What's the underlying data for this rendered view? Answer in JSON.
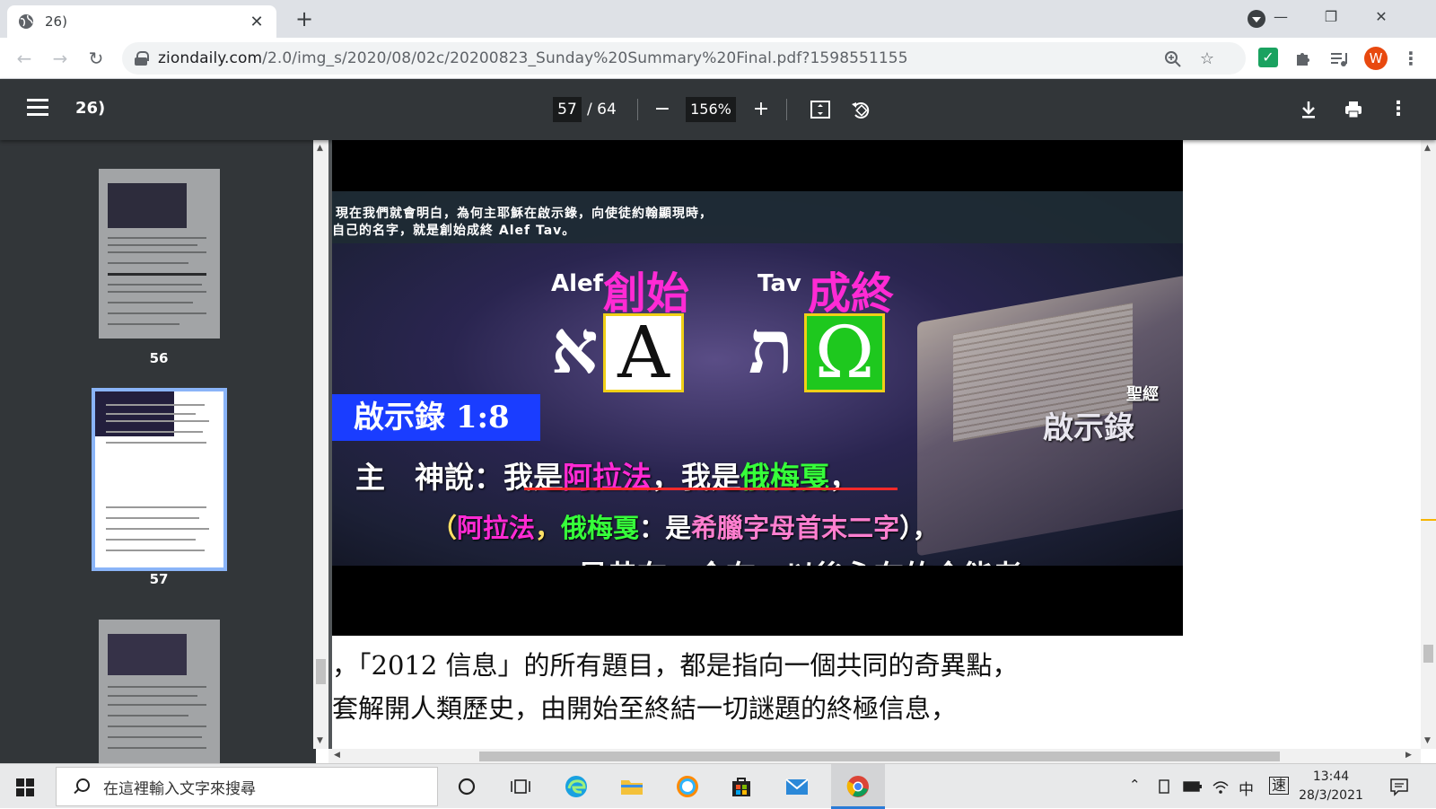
{
  "browser": {
    "tab_title": "26)",
    "tab_close": "✕",
    "new_tab": "+",
    "window_controls": [
      "—",
      "❐",
      "✕"
    ],
    "url_host": "ziondaily.com",
    "url_path": "/2.0/img_s/2020/08/02c/20200823_Sunday%20Summary%20Final.pdf?1598551155",
    "profile_initial": "W"
  },
  "pdf_toolbar": {
    "title": "26)",
    "current_page": "57",
    "page_separator": "/ 64",
    "zoom": "156%"
  },
  "sidebar": {
    "thumbnails": [
      {
        "page": "56"
      },
      {
        "page": "57"
      },
      {
        "page": ""
      }
    ]
  },
  "video_frame": {
    "caption_line1": "現在我們就會明白，為何主耶穌在啟示錄，向使徒約翰顯現時，",
    "caption_line2": "自己的名字，就是創始成終 Alef Tav。",
    "alef_label": "Alef",
    "alef_word": "創始",
    "tav_label": "Tav",
    "tav_word": "成終",
    "hebrew_alef": "א",
    "greek_alpha": "A",
    "hebrew_tav": "ת",
    "greek_omega": "Ω",
    "reference": "啟示錄 1:8",
    "bible_label_small": "聖經",
    "bible_label_big": "啟示錄",
    "line_a_prefix": "主　神說：我是",
    "line_a_alpha": "阿拉法",
    "line_a_mid": "，我是",
    "line_a_omega": "俄梅戛",
    "line_a_end": "，",
    "line_b_open": "（",
    "line_b_alpha": "阿拉法",
    "line_b_comma": "，",
    "line_b_omega": "俄梅戛",
    "line_b_colon": "：是",
    "line_b_desc": "希臘字母首末二字",
    "line_b_close": "），",
    "line_c": "是昔在、今在、以後永在的全能者。",
    "colors": {
      "magenta": "#ff2ad4",
      "green": "#36ff3a",
      "yellow": "#ffe066",
      "pink": "#ff7fd0"
    }
  },
  "page_body": {
    "line1": "，「2012 信息」的所有題目，都是指向一個共同的奇異點，",
    "line2": "套解開人類歷史，由開始至終結一切謎題的終極信息，"
  },
  "taskbar": {
    "search_placeholder": "在這裡輸入文字來搜尋",
    "ime_lang": "中",
    "ime_mode": "速",
    "time": "13:44",
    "date": "28/3/2021"
  }
}
